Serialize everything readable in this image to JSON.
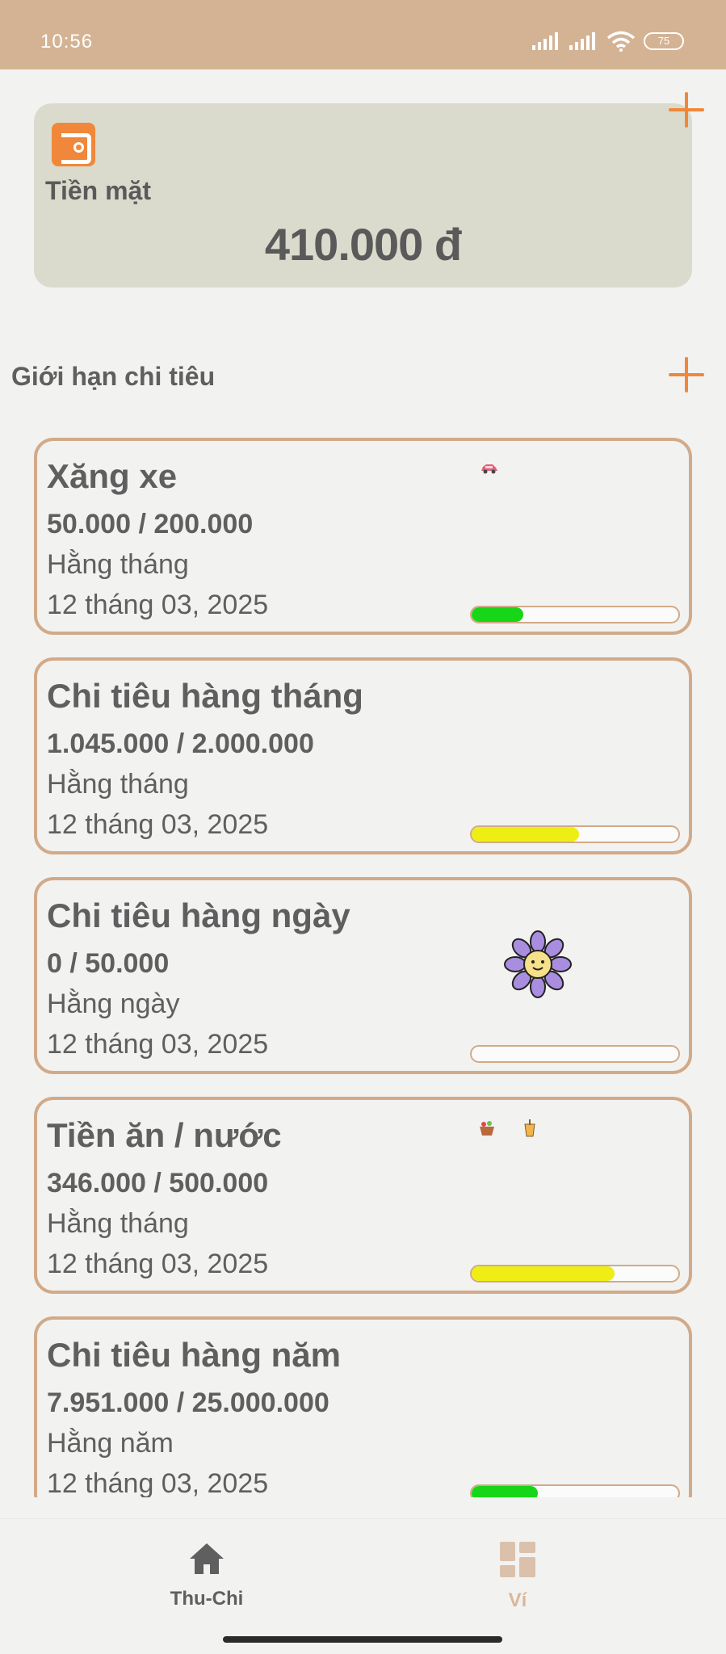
{
  "status_bar": {
    "time": "10:56",
    "battery": "75"
  },
  "wallet": {
    "name": "Tiền mặt",
    "amount": "410.000 đ",
    "icon": "wallet-icon",
    "accent_color": "#f0873a"
  },
  "section": {
    "title": "Giới hạn chi tiêu"
  },
  "budgets": [
    {
      "name": "Xăng xe",
      "amount": "50.000 / 200.000",
      "period": "Hằng tháng",
      "date": "12 tháng 03, 2025",
      "progress": 0.25,
      "bar_color": "#17d617",
      "sticker": "car-icon"
    },
    {
      "name": "Chi tiêu hàng tháng",
      "amount": "1.045.000 / 2.000.000",
      "period": "Hằng tháng",
      "date": "12 tháng 03, 2025",
      "progress": 0.52,
      "bar_color": "#eeee14",
      "sticker": ""
    },
    {
      "name": "Chi tiêu hàng ngày",
      "amount": "0 / 50.000",
      "period": "Hằng ngày",
      "date": "12 tháng 03, 2025",
      "progress": 0,
      "bar_color": "#17d617",
      "sticker": "flower-icon"
    },
    {
      "name": "Tiền ăn / nước",
      "amount": "346.000 / 500.000",
      "period": "Hằng tháng",
      "date": "12 tháng 03, 2025",
      "progress": 0.69,
      "bar_color": "#eeee14",
      "sticker": "food-drink-icons"
    },
    {
      "name": "Chi tiêu hàng năm",
      "amount": "7.951.000 / 25.000.000",
      "period": "Hằng năm",
      "date": "12 tháng 03, 2025",
      "progress": 0.32,
      "bar_color": "#17d617",
      "sticker": ""
    }
  ],
  "nav": {
    "items": [
      {
        "label": "Thu-Chi",
        "icon": "home-icon",
        "color": "#5f5f5f"
      },
      {
        "label": "Ví",
        "icon": "grid-icon",
        "color": "#d9b79a"
      }
    ]
  }
}
